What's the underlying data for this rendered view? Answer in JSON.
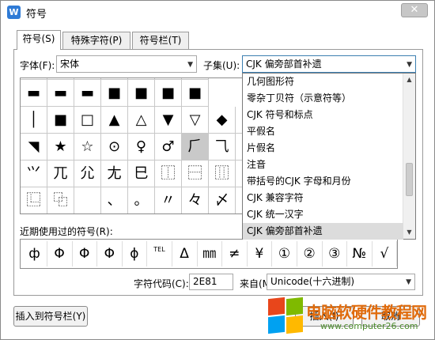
{
  "window": {
    "title": "符号",
    "app_icon": "W",
    "close_glyph": "✕"
  },
  "tabs": [
    {
      "label": "符号(S)"
    },
    {
      "label": "特殊字符(P)"
    },
    {
      "label": "符号栏(T)"
    }
  ],
  "font": {
    "label": "字体(F):",
    "value": "宋体"
  },
  "subset": {
    "label": "子集(U):",
    "value": "CJK 偏旁部首补遗"
  },
  "symbol_grid": [
    [
      "",
      "",
      "",
      "",
      "",
      "",
      ""
    ],
    [
      "▬",
      "▬",
      "▬",
      "■",
      "■",
      "■",
      "■"
    ],
    [
      "│",
      "■",
      "□",
      "▲",
      "△",
      "▼",
      "▽",
      "◆",
      "◇"
    ],
    [
      "◥",
      "★",
      "☆",
      "⊙",
      "♀",
      "♂",
      "⺁",
      "⺄",
      "⺈"
    ],
    [
      "⺍",
      "⺎",
      "⺏",
      "⺐",
      "⺒",
      "⿰",
      "⿱",
      "⿲",
      "⿳"
    ],
    [
      "⿺",
      "⿻",
      "",
      "、",
      "。",
      "〃",
      "々",
      "〆",
      "○"
    ]
  ],
  "subset_dropdown": {
    "items": [
      "几何图形符",
      "零杂丁贝符（示意符等）",
      "CJK 符号和标点",
      "平假名",
      "片假名",
      "注音",
      "带括号的CJK 字母和月份",
      "CJK 兼容字符",
      "CJK 统一汉字",
      "CJK 偏旁部首补遗"
    ],
    "selected_index": 9
  },
  "recent": {
    "label": "近期使用过的符号(R):",
    "symbols": [
      "ф",
      "Φ",
      "Φ",
      "Φ",
      "ϕ",
      "TEL",
      "Δ",
      "㎜",
      "≠",
      "¥",
      "①",
      "②",
      "③",
      "№",
      "√"
    ]
  },
  "char_code": {
    "label": "字符代码(C):",
    "value": "2E81"
  },
  "from": {
    "label": "来自(M)",
    "value": "Unicode(十六进制)"
  },
  "buttons": {
    "insert_to_bar": "插入到符号栏(Y)",
    "insert": "插入(I)",
    "cancel": "取消"
  },
  "watermark": {
    "title": "电脑软硬件教程网",
    "url": "www.computer26.com"
  },
  "colors": {
    "accent": "#2f7bd6",
    "watermark_orange": "#e06b0c",
    "watermark_green": "#4a8a2a"
  }
}
